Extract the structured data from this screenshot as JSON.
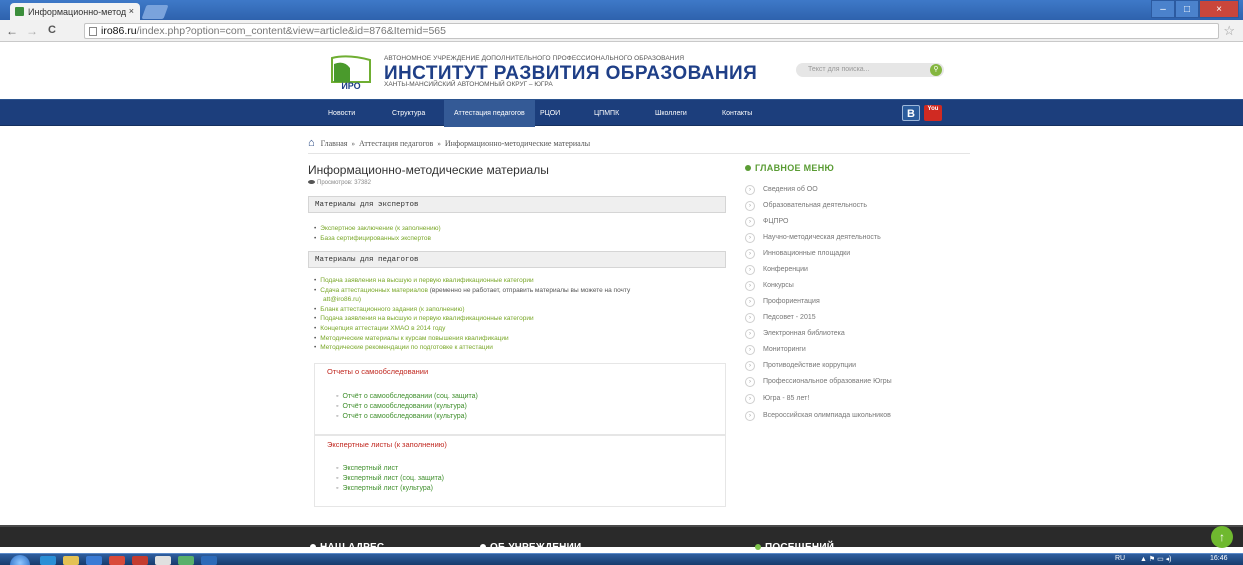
{
  "browser": {
    "tab_title": "Информационно-метод",
    "tab_close": "×",
    "url_domain": "iro86.ru",
    "url_path": "/index.php?option=com_content&view=article&id=876&Itemid=565",
    "back": "←",
    "forward": "→",
    "reload": "C",
    "bookmark": "☆",
    "win_minimize": "–",
    "win_maximize": "□",
    "win_close": "×"
  },
  "header": {
    "logo_text": "ИРО",
    "org_sub": "АВТОНОМНОЕ УЧРЕЖДЕНИЕ ДОПОЛНИТЕЛЬНОГО ПРОФЕССИОНАЛЬНОГО ОБРАЗОВАНИЯ",
    "org_title": "ИНСТИТУТ РАЗВИТИЯ ОБРАЗОВАНИЯ",
    "org_region": "ХАНТЫ-МАНСИЙСКИЙ АВТОНОМНЫЙ ОКРУГ – ЮГРА",
    "search_placeholder": "Текст для поиска...",
    "search_icon": "search-icon"
  },
  "menu": {
    "items": [
      "Новости",
      "Структура",
      "Аттестация педагогов",
      "РЦОИ",
      "ЦПМПК",
      "Школлеги",
      "Контакты"
    ],
    "active": "Аттестация педагогов",
    "vk": "B",
    "youtube": "You"
  },
  "breadcrumb": {
    "home": "Главная",
    "level1": "Аттестация педагогов",
    "current": "Информационно-методические материалы",
    "separator": "»"
  },
  "article": {
    "title": "Информационно-методические материалы",
    "views": "Просмотров: 37382",
    "section_experts": "Материалы для экспертов",
    "experts_links": [
      "Экспертное заключение (к заполнению)",
      "База сертифицированных экспертов"
    ],
    "section_teachers": "Материалы для педагогов",
    "teachers_links": {
      "l1": "Подача заявления на высшую и первую квалификационные категории",
      "l2_link": "Сдача аттестационных материалов",
      "l2_rest": " (временно не работает, отправить материалы вы можете на почту",
      "l2_email": "att@iro86.ru)",
      "l3": "Бланк аттестационного задания (к заполнению)",
      "l4": "Подача заявления на высшую и первую квалификационные категории",
      "l5": "Концепция аттестации ХМАО в 2014 году",
      "l6": "Методические материалы к курсам повышения квалификации",
      "l7": "Методические рекомендации по подготовке к аттестации"
    },
    "self_reports_title": "Отчеты о самообследовании",
    "self_reports": [
      "Отчёт о самообследовании (соц. защита)",
      "Отчёт о самообследовании (культура)",
      "Отчёт о самообследовании (культура)"
    ],
    "expert_sheets_title": "Экспертные листы (к заполнению)",
    "expert_sheets": [
      "Экспертный лист",
      "Экспертный лист (соц. защита)",
      "Экспертный лист (культура)"
    ]
  },
  "sidebar": {
    "title": "ГЛАВНОЕ МЕНЮ",
    "items": [
      "Сведения об ОО",
      "Образовательная деятельность",
      "ФЦПРО",
      "Научно-методическая деятельность",
      "Инновационные площадки",
      "Конференции",
      "Конкурсы",
      "Профориентация",
      "Педсовет - 2015",
      "Электронная библиотека",
      "Мониторинги",
      "Противодействие коррупции",
      "Профессиональное образование Югры",
      "Югра - 85 лет!",
      "Всероссийская олимпиада школьников"
    ],
    "chevron": "›"
  },
  "footer": {
    "address": "НАШ АДРЕС",
    "about": "ОБ УЧРЕЖДЕНИИ",
    "visits": "ПОСЕЩЕНИЙ",
    "to_top": "↑"
  },
  "taskbar": {
    "lang": "RU",
    "clock": "16:46"
  },
  "colors": {
    "menu_bg": "#1c3e7c",
    "accent_green": "#79a728",
    "report_red": "#c0271f"
  }
}
